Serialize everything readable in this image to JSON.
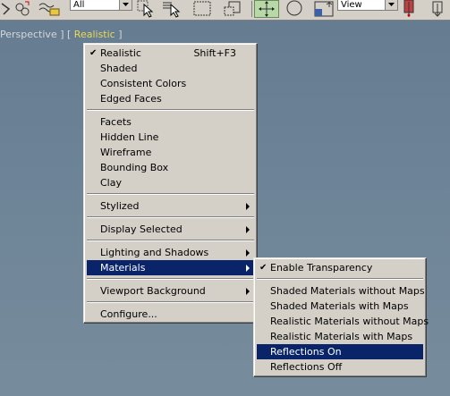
{
  "toolbar": {
    "selection_filter": "All",
    "reference_coord": "View",
    "icons": [
      "snap-icon",
      "link-icon",
      "bind-icon",
      "select-object-icon",
      "select-by-name-icon",
      "rect-region-icon",
      "window-crossing-icon",
      "move-icon",
      "rotate-icon",
      "scale-icon",
      "pivot-icon"
    ]
  },
  "viewport": {
    "label_prefix": "Perspective ] [",
    "label_shading": "Realistic",
    "label_suffix": "]",
    "label_open": ""
  },
  "menu": {
    "items": [
      {
        "label": "Realistic",
        "shortcut": "Shift+F3",
        "checked": true
      },
      {
        "label": "Shaded"
      },
      {
        "label": "Consistent Colors"
      },
      {
        "label": "Edged Faces"
      },
      {
        "label": "Facets"
      },
      {
        "label": "Hidden Line"
      },
      {
        "label": "Wireframe"
      },
      {
        "label": "Bounding Box"
      },
      {
        "label": "Clay"
      },
      {
        "label": "Stylized"
      },
      {
        "label": "Display Selected"
      },
      {
        "label": "Lighting and Shadows"
      },
      {
        "label": "Materials"
      },
      {
        "label": "Viewport Background"
      },
      {
        "label": "Configure..."
      }
    ]
  },
  "submenu": {
    "items": [
      {
        "label": "Enable Transparency",
        "checked": true
      },
      {
        "label": "Shaded Materials without Maps"
      },
      {
        "label": "Shaded Materials with Maps"
      },
      {
        "label": "Realistic Materials without Maps"
      },
      {
        "label": "Realistic Materials with Maps"
      },
      {
        "label": "Reflections On"
      },
      {
        "label": "Reflections Off"
      }
    ]
  },
  "colors": {
    "menu_bg": "#d4d0c8",
    "highlight": "#0a246a",
    "viewport_bg": "#6c8397",
    "label_highlight": "#e8d85a"
  }
}
